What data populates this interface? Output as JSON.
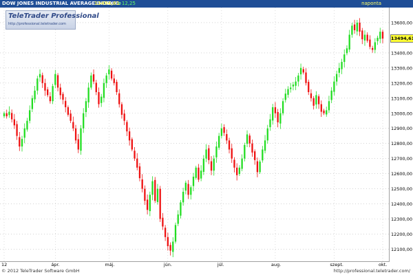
{
  "header": {
    "title": "DOW JONES INDUSTRIAL AVERAGE INDEX C:",
    "last": "13494,61",
    "change": "+12,25",
    "period": "naponta"
  },
  "logo": {
    "name": "TeleTrader Professional",
    "url": "http://professional.teletrader.com"
  },
  "footer": {
    "copyright": "© 2012 TeleTrader Software GmbH",
    "url": "http://professional.teletrader.com/"
  },
  "colors": {
    "header_bg": "#1f4e96",
    "up": "#22dd22",
    "down": "#ee1111",
    "price_badge": "#ffff33"
  },
  "chart_data": {
    "type": "candlestick",
    "title": "DOW JONES INDUSTRIAL AVERAGE INDEX",
    "ylim": [
      12020,
      13700
    ],
    "yticks": [
      {
        "value": 12100,
        "label": "12100,00"
      },
      {
        "value": 12200,
        "label": "12200,00"
      },
      {
        "value": 12300,
        "label": "12300,00"
      },
      {
        "value": 12400,
        "label": "12400,00"
      },
      {
        "value": 12500,
        "label": "12500,00"
      },
      {
        "value": 12600,
        "label": "12600,00"
      },
      {
        "value": 12700,
        "label": "12700,00"
      },
      {
        "value": 12800,
        "label": "12800,00"
      },
      {
        "value": 12900,
        "label": "12900,00"
      },
      {
        "value": 13000,
        "label": "13000,00"
      },
      {
        "value": 13100,
        "label": "13100,00"
      },
      {
        "value": 13200,
        "label": "13200,00"
      },
      {
        "value": 13300,
        "label": "13300,00"
      },
      {
        "value": 13400,
        "label": "13400,00"
      },
      {
        "value": 13600,
        "label": "13600,00"
      }
    ],
    "xticks": [
      {
        "index": 0,
        "label": "12"
      },
      {
        "index": 20,
        "label": "ápr."
      },
      {
        "index": 41,
        "label": "máj."
      },
      {
        "index": 64,
        "label": "jún."
      },
      {
        "index": 85,
        "label": "júl."
      },
      {
        "index": 106,
        "label": "aug."
      },
      {
        "index": 129,
        "label": "szept."
      },
      {
        "index": 148,
        "label": "okt."
      }
    ],
    "last_price": 13494.61,
    "last_price_label": "13494,61",
    "grid": true,
    "closes": [
      13000,
      12980,
      13010,
      12960,
      12920,
      12850,
      12780,
      12830,
      12900,
      12950,
      13020,
      13100,
      13150,
      13230,
      13260,
      13200,
      13150,
      13120,
      13080,
      13180,
      13260,
      13170,
      13120,
      13090,
      13040,
      12990,
      12950,
      12900,
      12820,
      12760,
      12900,
      13000,
      13080,
      13170,
      13250,
      13210,
      13140,
      13060,
      13110,
      13200,
      13250,
      13290,
      13230,
      13200,
      13140,
      13060,
      12990,
      12950,
      12880,
      12820,
      12760,
      12700,
      12640,
      12570,
      12500,
      12420,
      12360,
      12460,
      12550,
      12420,
      12500,
      12300,
      12250,
      12180,
      12120,
      12090,
      12150,
      12260,
      12330,
      12410,
      12480,
      12540,
      12460,
      12510,
      12580,
      12640,
      12560,
      12620,
      12700,
      12760,
      12690,
      12620,
      12700,
      12780,
      12850,
      12900,
      12870,
      12820,
      12760,
      12700,
      12640,
      12590,
      12640,
      12700,
      12790,
      12860,
      12800,
      12740,
      12690,
      12610,
      12680,
      12760,
      12820,
      12900,
      12960,
      13040,
      13000,
      12940,
      13000,
      13080,
      13130,
      13160,
      13170,
      13190,
      13210,
      13250,
      13300,
      13270,
      13200,
      13140,
      13100,
      13050,
      13120,
      13060,
      13010,
      13000,
      13020,
      13080,
      13150,
      13210,
      13260,
      13300,
      13340,
      13390,
      13430,
      13520,
      13580,
      13550,
      13600,
      13540,
      13490,
      13520,
      13480,
      13440,
      13420,
      13470,
      13500,
      13540,
      13494.61
    ]
  }
}
